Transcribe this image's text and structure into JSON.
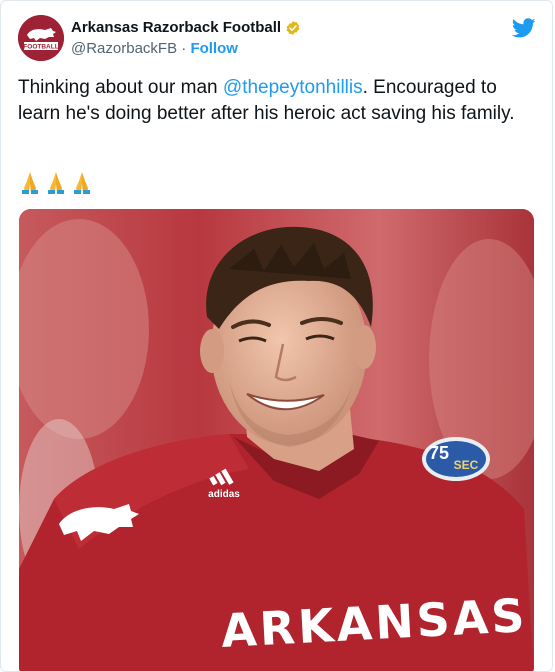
{
  "account": {
    "display_name": "Arkansas Razorback Football",
    "handle": "@RazorbackFB",
    "separator": "·",
    "follow_label": "Follow",
    "verified": true,
    "avatar_label": "FOOTBALL"
  },
  "tweet": {
    "text_before": "Thinking about our man ",
    "mention": "@thepeytonhillis",
    "text_after": ". Encouraged to learn he's doing better after his heroic act saving his family.",
    "emojis": [
      "🙏",
      "🙏",
      "🙏"
    ]
  },
  "photo": {
    "jersey_text": "ARKANSAS",
    "patch_text_top": "75",
    "patch_text_bottom": "SEC",
    "brand": "adidas"
  },
  "colors": {
    "brand_red": "#9d2235",
    "twitter_blue": "#1d9bf0",
    "verified_gold": "#e2b719"
  },
  "icons": {
    "platform": "twitter-bird-icon",
    "verified": "verified-badge-icon",
    "emoji": "folded-hands-emoji"
  }
}
